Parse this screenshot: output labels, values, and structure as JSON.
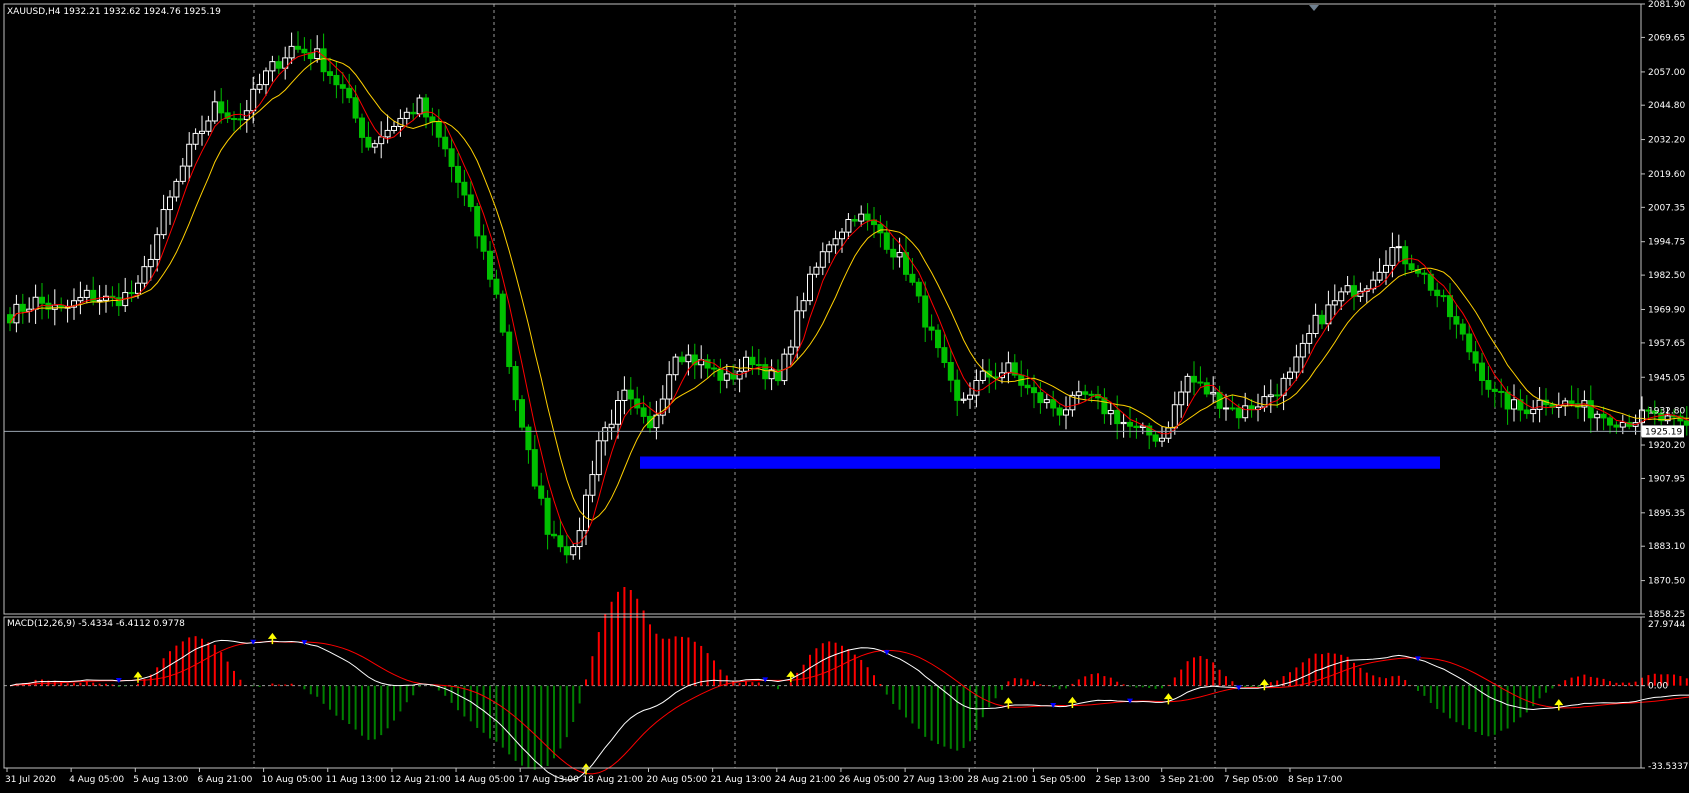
{
  "header": {
    "symbol_line": "XAUUSD,H4  1932.21 1932.62 1924.76 1925.19",
    "macd_line": "MACD(12,26,9) -5.4334 -6.4112 0.9778"
  },
  "colors": {
    "background": "#000000",
    "frame": "#c0c0c0",
    "grid": "#c0c0c0",
    "bull_candle": "#ffffff",
    "bear_candle": "#00c000",
    "ma_fast": "#ff0000",
    "ma_slow": "#ffd000",
    "support_zone": "#0000ff",
    "macd_line": "#ffffff",
    "signal_line": "#ff0000",
    "hist_pos": "#ff0000",
    "hist_neg": "#008000",
    "arrow_up": "#ffff00",
    "arrow_down": "#0000ff",
    "current_price_line": "#9aa4b0"
  },
  "chart_data": [
    {
      "type": "candlestick",
      "title": "XAUUSD,H4",
      "ylim": [
        1858.25,
        2081.9
      ],
      "price_ticks": [
        "2081.90",
        "2069.65",
        "2057.00",
        "2044.80",
        "2032.20",
        "2019.60",
        "2007.35",
        "1994.75",
        "1982.50",
        "1969.90",
        "1957.65",
        "1945.05",
        "1932.80",
        "1920.20",
        "1907.95",
        "1895.35",
        "1883.10",
        "1870.50",
        "1858.25"
      ],
      "current_price": "1925.19",
      "time_labels": [
        "31 Jul 2020",
        "4 Aug 05:00",
        "5 Aug 13:00",
        "6 Aug 21:00",
        "10 Aug 05:00",
        "11 Aug 13:00",
        "12 Aug 21:00",
        "14 Aug 05:00",
        "17 Aug 13:00",
        "18 Aug 21:00",
        "20 Aug 05:00",
        "21 Aug 13:00",
        "24 Aug 21:00",
        "26 Aug 05:00",
        "27 Aug 13:00",
        "28 Aug 21:00",
        "1 Sep 05:00",
        "2 Sep 13:00",
        "3 Sep 21:00",
        "7 Sep 05:00",
        "8 Sep 17:00"
      ],
      "support_zone": {
        "low": 1911.5,
        "high": 1916.0
      },
      "price_path_anchors": [
        1968,
        1973,
        1969,
        1975,
        1973,
        1977,
        2004,
        2028,
        2044,
        2040,
        2056,
        2066,
        2063,
        2050,
        2030,
        2038,
        2045,
        2028,
        2005,
        1975,
        1925,
        1890,
        1880,
        1922,
        1938,
        1925,
        1955,
        1950,
        1944,
        1952,
        1943,
        1975,
        1995,
        2005,
        1998,
        1985,
        1960,
        1935,
        1945,
        1948,
        1938,
        1933,
        1938,
        1932,
        1925,
        1923,
        1945,
        1938,
        1932,
        1937,
        1945,
        1965,
        1975,
        1980,
        1992,
        1985,
        1972,
        1955,
        1938,
        1933,
        1937,
        1935,
        1932,
        1929,
        1931,
        1928,
        1925
      ],
      "ma_fast_period": 5,
      "ma_slow_period": 10
    },
    {
      "type": "macd",
      "title": "MACD(12,26,9)",
      "values": {
        "macd": -5.4334,
        "signal": -6.4112,
        "histogram": 0.9778
      },
      "ylim": [
        -33.5337,
        27.9744
      ],
      "tick_labels": [
        "27.9744",
        "0.00",
        "-33.5337"
      ],
      "histogram_scale": 3.2
    }
  ]
}
